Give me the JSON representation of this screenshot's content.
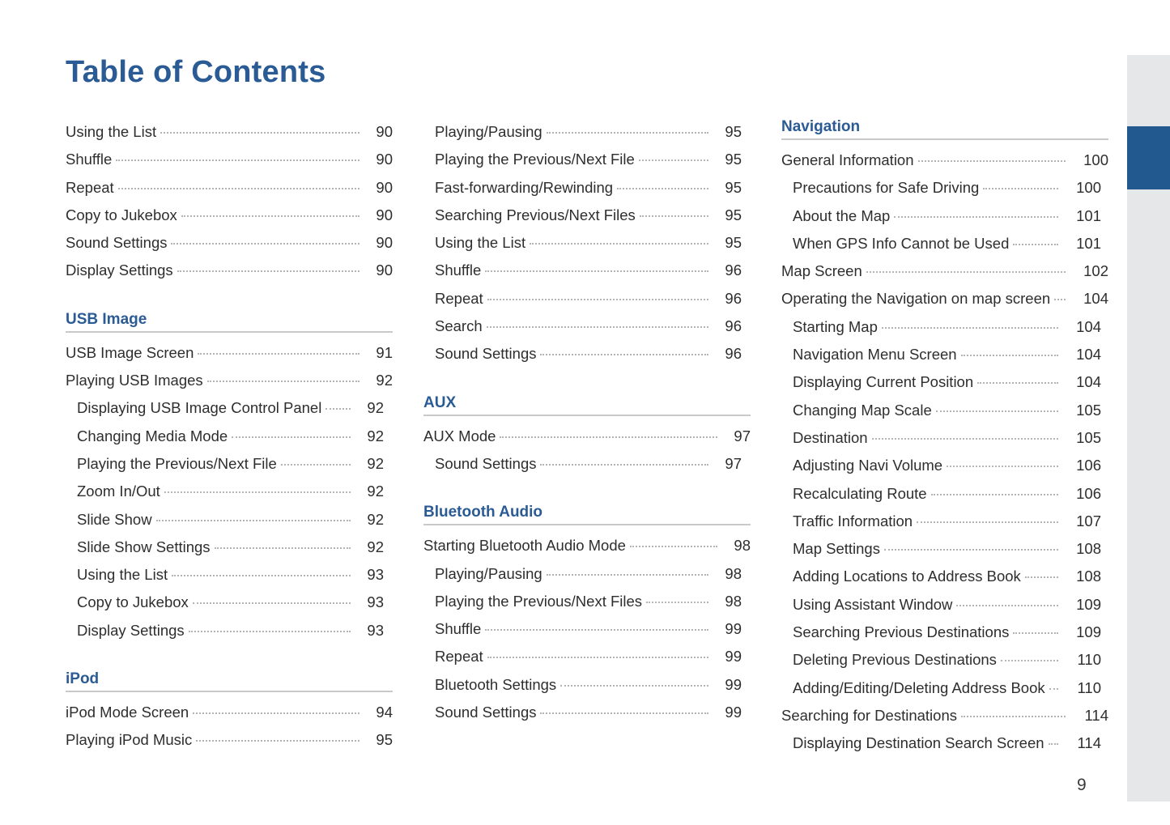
{
  "page_title": "Table of Contents",
  "folio": "9",
  "colors": {
    "heading_blue": "#2b5b95",
    "tab_marker_blue": "#22598f",
    "tab_strip_gray": "#e6e7e8",
    "rule_gray": "#c9c9c9",
    "body_text": "#2e2e2e"
  },
  "tab_strip": {
    "name": "side-tab-strip",
    "marker_name": "active-chapter-tab-marker"
  },
  "columns": [
    {
      "name": "column-1",
      "sections": [
        {
          "header": "",
          "has_header": false,
          "entries": [
            {
              "label": "Using the List",
              "page": "90",
              "level": 1
            },
            {
              "label": "Shuffle",
              "page": "90",
              "level": 1
            },
            {
              "label": "Repeat",
              "page": "90",
              "level": 1
            },
            {
              "label": "Copy to Jukebox",
              "page": "90",
              "level": 1
            },
            {
              "label": "Sound Settings",
              "page": "90",
              "level": 1
            },
            {
              "label": "Display Settings",
              "page": "90",
              "level": 1
            }
          ]
        },
        {
          "header": "USB Image",
          "has_header": true,
          "entries": [
            {
              "label": "USB Image Screen",
              "page": "91",
              "level": 1
            },
            {
              "label": "Playing USB Images",
              "page": "92",
              "level": 1
            },
            {
              "label": "Displaying USB Image Control Panel",
              "page": "92",
              "level": 2
            },
            {
              "label": "Changing Media Mode",
              "page": "92",
              "level": 2
            },
            {
              "label": "Playing the Previous/Next File",
              "page": "92",
              "level": 2
            },
            {
              "label": "Zoom In/Out",
              "page": "92",
              "level": 2
            },
            {
              "label": "Slide Show",
              "page": "92",
              "level": 2
            },
            {
              "label": "Slide Show Settings",
              "page": "92",
              "level": 2
            },
            {
              "label": "Using the List",
              "page": "93",
              "level": 2
            },
            {
              "label": "Copy to Jukebox",
              "page": "93",
              "level": 2
            },
            {
              "label": "Display Settings",
              "page": "93",
              "level": 2
            }
          ]
        },
        {
          "header": "iPod",
          "has_header": true,
          "entries": [
            {
              "label": "iPod Mode Screen",
              "page": "94",
              "level": 1
            },
            {
              "label": "Playing iPod Music",
              "page": "95",
              "level": 1
            }
          ]
        }
      ]
    },
    {
      "name": "column-2",
      "sections": [
        {
          "header": "",
          "has_header": false,
          "entries": [
            {
              "label": "Playing/Pausing",
              "page": "95",
              "level": 2
            },
            {
              "label": "Playing the Previous/Next File",
              "page": "95",
              "level": 2
            },
            {
              "label": "Fast-forwarding/Rewinding",
              "page": "95",
              "level": 2
            },
            {
              "label": "Searching Previous/Next Files",
              "page": "95",
              "level": 2
            },
            {
              "label": "Using the List",
              "page": "95",
              "level": 2
            },
            {
              "label": "Shuffle",
              "page": "96",
              "level": 2
            },
            {
              "label": "Repeat",
              "page": "96",
              "level": 2
            },
            {
              "label": "Search",
              "page": "96",
              "level": 2
            },
            {
              "label": "Sound Settings",
              "page": "96",
              "level": 2
            }
          ]
        },
        {
          "header": "AUX",
          "has_header": true,
          "entries": [
            {
              "label": "AUX Mode",
              "page": "97",
              "level": 1
            },
            {
              "label": "Sound Settings",
              "page": "97",
              "level": 2
            }
          ]
        },
        {
          "header": "Bluetooth Audio",
          "has_header": true,
          "entries": [
            {
              "label": "Starting Bluetooth Audio Mode",
              "page": "98",
              "level": 1
            },
            {
              "label": "Playing/Pausing",
              "page": "98",
              "level": 2
            },
            {
              "label": "Playing the Previous/Next Files",
              "page": "98",
              "level": 2
            },
            {
              "label": "Shuffle",
              "page": "99",
              "level": 2
            },
            {
              "label": "Repeat",
              "page": "99",
              "level": 2
            },
            {
              "label": "Bluetooth Settings",
              "page": "99",
              "level": 2
            },
            {
              "label": "Sound Settings",
              "page": "99",
              "level": 2
            }
          ]
        }
      ]
    },
    {
      "name": "column-3",
      "wide": true,
      "sections": [
        {
          "header": "Navigation",
          "has_header": true,
          "entries": [
            {
              "label": "General Information",
              "page": "100",
              "level": 1
            },
            {
              "label": "Precautions for Safe Driving",
              "page": "100",
              "level": 2
            },
            {
              "label": "About the Map",
              "page": "101",
              "level": 2
            },
            {
              "label": "When GPS Info Cannot be Used",
              "page": "101",
              "level": 2
            },
            {
              "label": "Map Screen",
              "page": "102",
              "level": 1
            },
            {
              "label": "Operating the Navigation on map screen",
              "page": "104",
              "level": 1
            },
            {
              "label": "Starting Map",
              "page": "104",
              "level": 2
            },
            {
              "label": "Navigation Menu Screen",
              "page": "104",
              "level": 2
            },
            {
              "label": "Displaying Current Position",
              "page": "104",
              "level": 2
            },
            {
              "label": "Changing Map Scale",
              "page": "105",
              "level": 2
            },
            {
              "label": "Destination",
              "page": "105",
              "level": 2
            },
            {
              "label": "Adjusting Navi Volume",
              "page": "106",
              "level": 2
            },
            {
              "label": "Recalculating Route",
              "page": "106",
              "level": 2
            },
            {
              "label": "Traffic Information",
              "page": "107",
              "level": 2
            },
            {
              "label": "Map Settings",
              "page": "108",
              "level": 2
            },
            {
              "label": "Adding Locations to Address Book",
              "page": "108",
              "level": 2
            },
            {
              "label": "Using Assistant Window",
              "page": "109",
              "level": 2
            },
            {
              "label": "Searching Previous Destinations",
              "page": "109",
              "level": 2
            },
            {
              "label": "Deleting Previous Destinations",
              "page": "110",
              "level": 2
            },
            {
              "label": "Adding/Editing/Deleting Address Book",
              "page": "110",
              "level": 2
            },
            {
              "label": "Searching for Destinations",
              "page": "114",
              "level": 1
            },
            {
              "label": "Displaying Destination Search Screen",
              "page": "114",
              "level": 2
            }
          ]
        }
      ]
    }
  ]
}
